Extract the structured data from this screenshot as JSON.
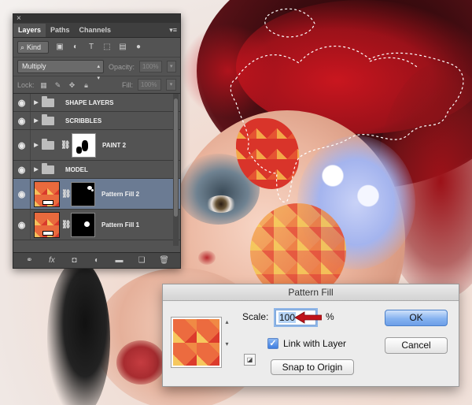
{
  "panel": {
    "tabs": [
      {
        "label": "Layers",
        "active": true
      },
      {
        "label": "Paths",
        "active": false
      },
      {
        "label": "Channels",
        "active": false
      }
    ],
    "filter": {
      "kind_label": "Kind",
      "icons": [
        "image-filter-icon",
        "adjustment-filter-icon",
        "type-filter-icon",
        "shape-filter-icon",
        "smart-object-filter-icon"
      ]
    },
    "blend_mode": "Multiply",
    "opacity_label": "Opacity:",
    "opacity_value": "100%",
    "lock_label": "Lock:",
    "fill_label": "Fill:",
    "fill_value": "100%",
    "layers": [
      {
        "name": "SHAPE LAYERS",
        "type": "group",
        "visible": true
      },
      {
        "name": "SCRIBBLES",
        "type": "group",
        "visible": true
      },
      {
        "name": "PAINT 2",
        "type": "group-masked",
        "visible": true
      },
      {
        "name": "MODEL",
        "type": "group",
        "visible": true
      },
      {
        "name": "Pattern Fill 2",
        "type": "fill",
        "visible": true,
        "selected": true
      },
      {
        "name": "Pattern Fill 1",
        "type": "fill",
        "visible": true,
        "selected": false
      }
    ],
    "footer_icons": [
      "link-layers-icon",
      "fx-icon",
      "add-mask-icon",
      "adjustment-layer-icon",
      "new-group-icon",
      "new-layer-icon",
      "trash-icon"
    ]
  },
  "dialog": {
    "title": "Pattern Fill",
    "scale_label": "Scale:",
    "scale_value": "100",
    "percent": "%",
    "link_label": "Link with Layer",
    "link_checked": true,
    "snap_label": "Snap to Origin",
    "ok_label": "OK",
    "cancel_label": "Cancel"
  },
  "colors": {
    "panel_bg": "#535353",
    "selected_row": "#6b7b93",
    "ok_accent": "#6c9ee8",
    "annotation_arrow": "#c0141b"
  }
}
